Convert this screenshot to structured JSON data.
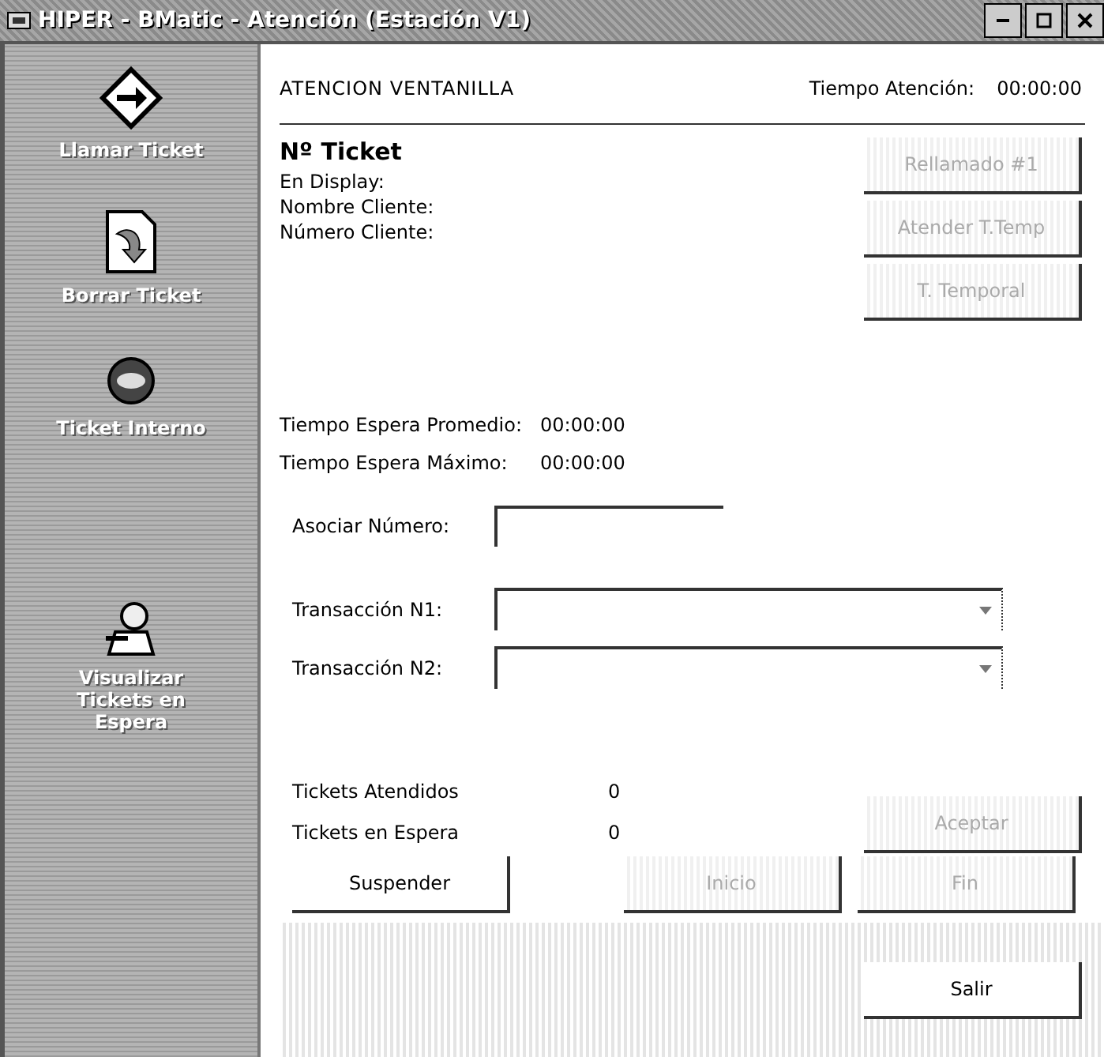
{
  "window": {
    "title": "HIPER - BMatic - Atención (Estación V1)"
  },
  "sidebar": {
    "items": [
      {
        "kind": "call",
        "label": "Llamar Ticket"
      },
      {
        "kind": "delete",
        "label": "Borrar Ticket"
      },
      {
        "kind": "internal",
        "label": "Ticket Interno"
      },
      {
        "kind": "queue",
        "label": "Visualizar Tickets en Espera"
      }
    ]
  },
  "header": {
    "title": "ATENCION VENTANILLA",
    "time_label": "Tiempo Atención:",
    "time_value": "00:00:00"
  },
  "ticket": {
    "title": "Nº Ticket",
    "fields": [
      "En Display:",
      "Nombre Cliente:",
      "Número Cliente:"
    ]
  },
  "side_buttons": [
    {
      "label": "Rellamado #1",
      "disabled": true
    },
    {
      "label": "Atender T.Temp",
      "disabled": true
    },
    {
      "label": "T. Temporal",
      "disabled": true
    }
  ],
  "wait_times": [
    {
      "label": "Tiempo Espera Promedio:",
      "value": "00:00:00"
    },
    {
      "label": "Tiempo Espera Máximo:",
      "value": "00:00:00"
    }
  ],
  "associate": {
    "label": "Asociar Número:"
  },
  "transactions": [
    {
      "label": "Transacción N1:"
    },
    {
      "label": "Transacción N2:"
    }
  ],
  "counters": [
    {
      "label": "Tickets Atendidos",
      "value": "0"
    },
    {
      "label": "Tickets en Espera",
      "value": "0"
    }
  ],
  "accept_button": {
    "label": "Aceptar",
    "disabled": true
  },
  "action_buttons": [
    {
      "label": "Suspender",
      "disabled": false
    },
    {
      "label": "Inicio",
      "disabled": true
    },
    {
      "label": "Fin",
      "disabled": true
    }
  ],
  "exit_button": {
    "label": "Salir",
    "disabled": false
  }
}
